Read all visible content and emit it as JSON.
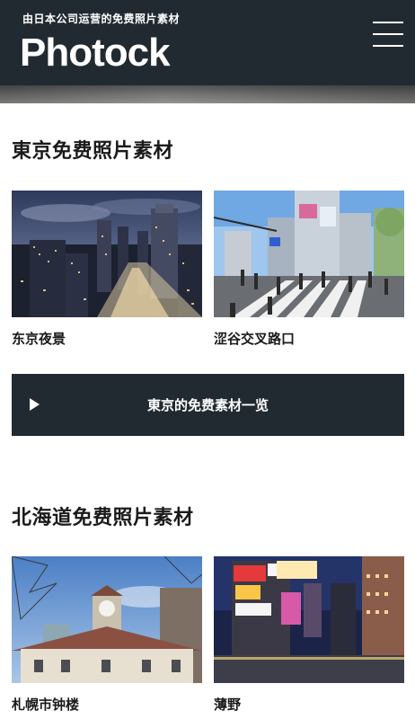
{
  "header": {
    "tagline": "由日本公司运营的免费照片素材",
    "logo": "Photock"
  },
  "sections": [
    {
      "title": "東京免费照片素材",
      "cards": [
        {
          "label": "东京夜景"
        },
        {
          "label": "涩谷交叉路口"
        }
      ],
      "list_button": {
        "label": "東京的免费素材一览"
      }
    },
    {
      "title": "北海道免费照片素材",
      "cards": [
        {
          "label": "札幌市钟楼"
        },
        {
          "label": "薄野"
        }
      ]
    }
  ],
  "icons": {
    "menu": "hamburger-menu-icon",
    "play": "play-triangle-icon"
  }
}
